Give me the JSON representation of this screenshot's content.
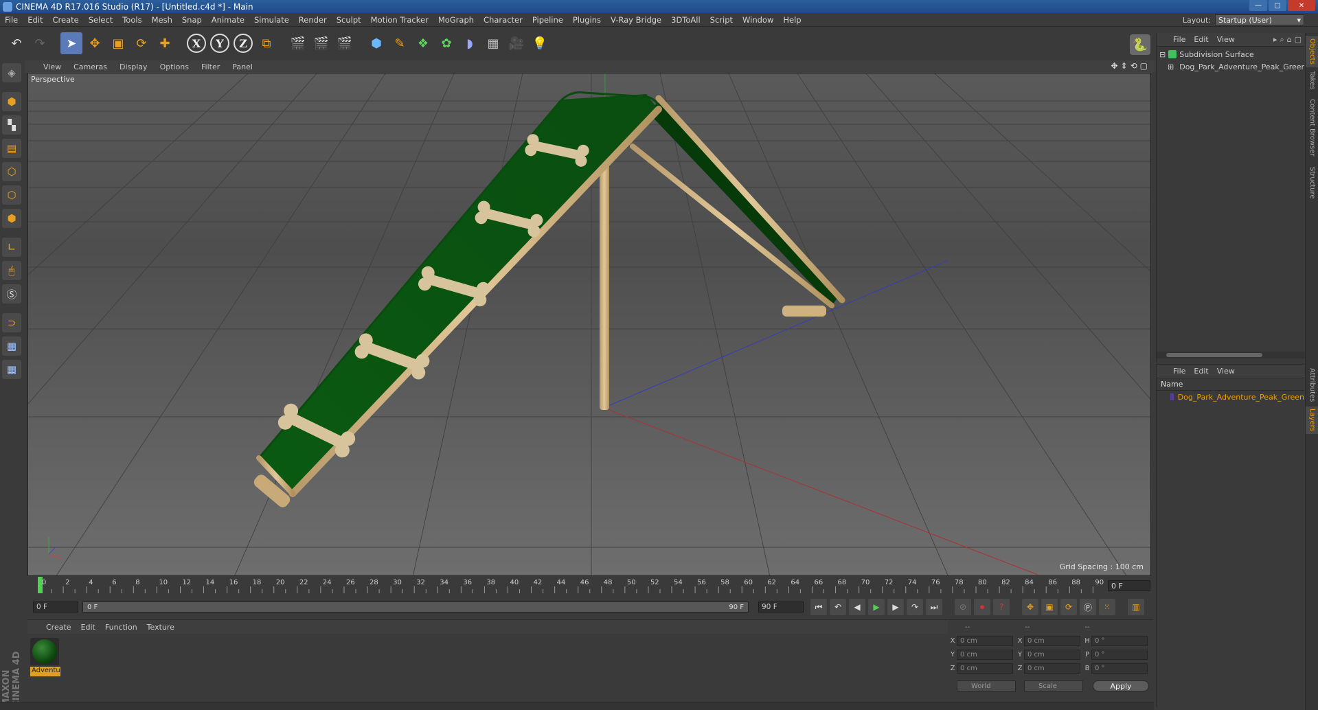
{
  "window": {
    "title": "CINEMA 4D R17.016 Studio (R17) - [Untitled.c4d *] - Main",
    "controls": [
      "—",
      "▢",
      "✕"
    ]
  },
  "menubar": {
    "items": [
      "File",
      "Edit",
      "Create",
      "Select",
      "Tools",
      "Mesh",
      "Snap",
      "Animate",
      "Simulate",
      "Render",
      "Sculpt",
      "Motion Tracker",
      "MoGraph",
      "Character",
      "Pipeline",
      "Plugins",
      "V-Ray Bridge",
      "3DToAll",
      "Script",
      "Window",
      "Help"
    ],
    "layout_label": "Layout:",
    "layout_value": "Startup (User)"
  },
  "toolbar": {
    "axis_x": "X",
    "axis_y": "Y",
    "axis_z": "Z"
  },
  "viewport": {
    "menu": [
      "View",
      "Cameras",
      "Display",
      "Options",
      "Filter",
      "Panel"
    ],
    "camera_label": "Perspective",
    "grid_spacing": "Grid Spacing : 100 cm"
  },
  "timeline": {
    "ticks": [
      "0",
      "2",
      "4",
      "6",
      "8",
      "10",
      "12",
      "14",
      "16",
      "18",
      "20",
      "22",
      "24",
      "26",
      "28",
      "30",
      "32",
      "34",
      "36",
      "38",
      "40",
      "42",
      "44",
      "46",
      "48",
      "50",
      "52",
      "54",
      "56",
      "58",
      "60",
      "62",
      "64",
      "66",
      "68",
      "70",
      "72",
      "74",
      "76",
      "78",
      "80",
      "82",
      "84",
      "86",
      "88",
      "90"
    ],
    "current_frame": "0 F",
    "start_field": "0 F",
    "range_start": "0 F",
    "range_end": "90 F",
    "end_field": "90 F"
  },
  "material_manager": {
    "menu": [
      "Create",
      "Edit",
      "Function",
      "Texture"
    ],
    "material_name": "Adventu",
    "material_color": "#0f4a0f"
  },
  "coordinates": {
    "headers": [
      "--",
      "--",
      "--"
    ],
    "rows": [
      {
        "a_label": "X",
        "a_value": "0 cm",
        "b_label": "X",
        "b_value": "0 cm",
        "c_label": "H",
        "c_value": "0 °"
      },
      {
        "a_label": "Y",
        "a_value": "0 cm",
        "b_label": "Y",
        "b_value": "0 cm",
        "c_label": "P",
        "c_value": "0 °"
      },
      {
        "a_label": "Z",
        "a_value": "0 cm",
        "b_label": "Z",
        "b_value": "0 cm",
        "c_label": "B",
        "c_value": "0 °"
      }
    ],
    "coord_system": "World",
    "mode": "Scale",
    "apply_label": "Apply"
  },
  "object_manager": {
    "menu": [
      "File",
      "Edit",
      "View"
    ],
    "objects": [
      {
        "name": "Subdivision Surface",
        "icon_color": "#44c060"
      },
      {
        "name": "Dog_Park_Adventure_Peak_Green",
        "icon_color": "#6a8acb"
      }
    ]
  },
  "layer_manager": {
    "menu": [
      "File",
      "Edit",
      "View"
    ],
    "header_name": "Name",
    "layers": [
      {
        "name": "Dog_Park_Adventure_Peak_Green",
        "color": "#5a3aa0"
      }
    ]
  },
  "side_tabs": [
    "Objects",
    "Takes",
    "Content Browser",
    "Structure",
    "Attributes",
    "Layers"
  ],
  "branding": "MAXON CINEMA 4D",
  "colors": {
    "accent": "#e8a020",
    "ramp_green": "#0b5512",
    "frame_tan": "#d4b88a",
    "selection_blue": "#5a7ab8"
  }
}
